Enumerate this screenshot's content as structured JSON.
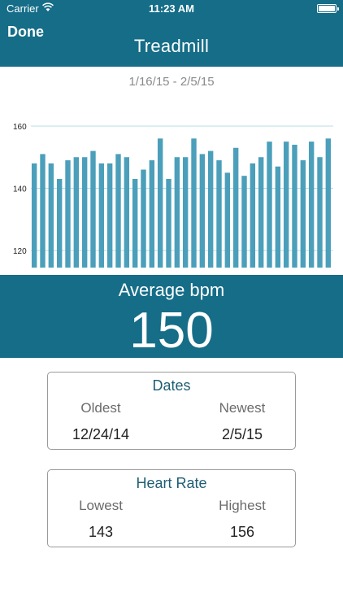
{
  "status_bar": {
    "carrier": "Carrier",
    "time": "11:23 AM"
  },
  "nav": {
    "done_label": "Done",
    "title": "Treadmill"
  },
  "colors": {
    "header": "#156d88",
    "bar": "#4b9fba",
    "grid": "#b8dce6"
  },
  "date_range": "1/16/15 - 2/5/15",
  "chart_data": {
    "type": "bar",
    "categories": [],
    "values": [
      148,
      151,
      148,
      143,
      149,
      150,
      150,
      152,
      148,
      148,
      151,
      150,
      143,
      146,
      149,
      156,
      143,
      150,
      150,
      156,
      151,
      152,
      149,
      145,
      153,
      144,
      148,
      150,
      155,
      147,
      155,
      154,
      149,
      155,
      150,
      156
    ],
    "title": "",
    "xlabel": "",
    "ylabel": "",
    "ylim": [
      114.5,
      160
    ],
    "yticks": [
      120,
      140,
      160
    ],
    "grid": true
  },
  "average": {
    "label": "Average bpm",
    "value": "150"
  },
  "dates_card": {
    "title": "Dates",
    "left_label": "Oldest",
    "left_value": "12/24/14",
    "right_label": "Newest",
    "right_value": "2/5/15"
  },
  "heart_card": {
    "title": "Heart Rate",
    "left_label": "Lowest",
    "left_value": "143",
    "right_label": "Highest",
    "right_value": "156"
  }
}
